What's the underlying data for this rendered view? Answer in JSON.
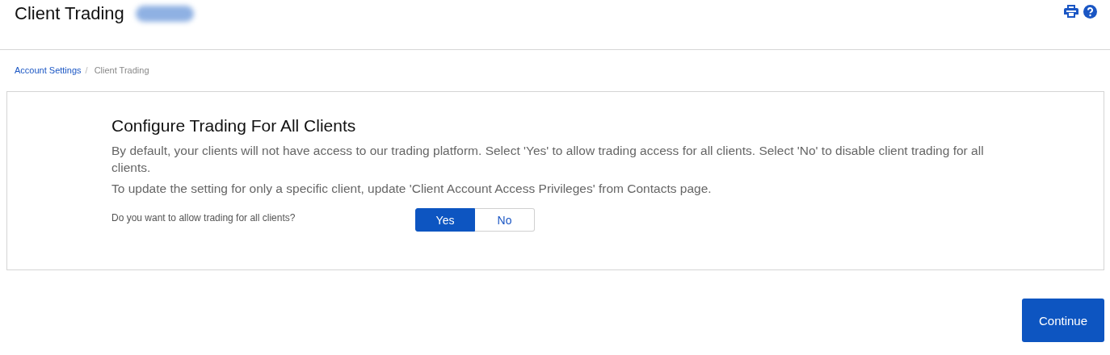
{
  "header": {
    "title": "Client Trading"
  },
  "breadcrumb": [
    {
      "label": "Account Settings",
      "kind": "link"
    },
    {
      "label": "/",
      "kind": "separator"
    },
    {
      "label": "Client Trading",
      "kind": "current"
    }
  ],
  "card": {
    "title": "Configure Trading For All Clients",
    "paragraphs": [
      "By default, your clients will not have access to our trading platform. Select 'Yes' to allow trading access for all clients. Select 'No' to disable client trading for all clients.",
      "To update the setting for only a specific client, update 'Client Account Access Privileges' from Contacts page."
    ],
    "question": "Do you want to allow trading for all clients?",
    "options": [
      {
        "label": "Yes",
        "selected": true
      },
      {
        "label": "No",
        "selected": false
      }
    ]
  },
  "continue_button": "Continue"
}
